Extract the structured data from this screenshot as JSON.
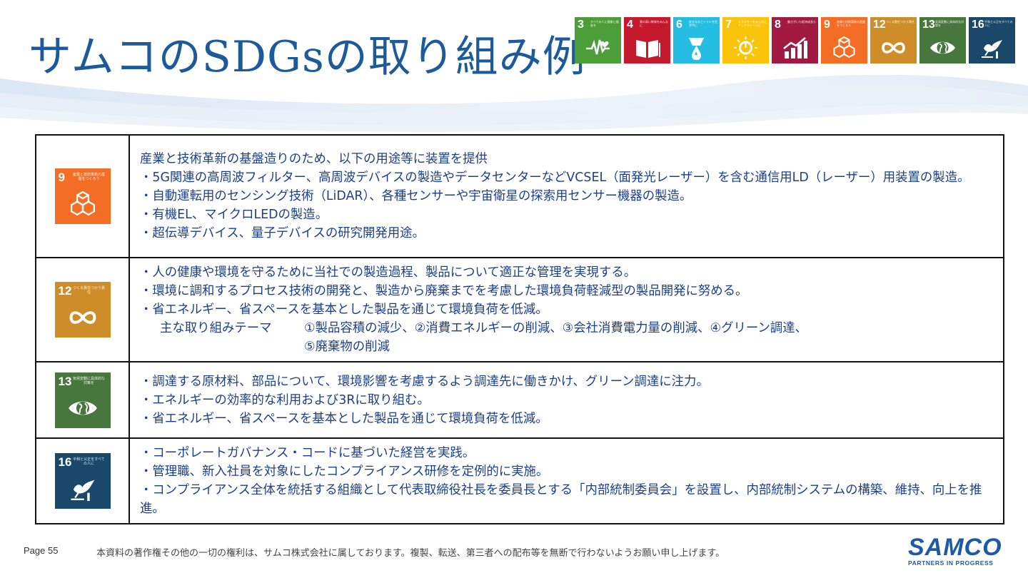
{
  "title": "サムコのSDGsの取り組み例",
  "header_icons": [
    {
      "number": "3",
      "caption": "すべての人に健康と福祉を",
      "color": "#4c9f38",
      "icon": "heartbeat-icon"
    },
    {
      "number": "4",
      "caption": "質の高い教育をみんなに",
      "color": "#c5192d",
      "icon": "book-icon"
    },
    {
      "number": "6",
      "caption": "安全な水とトイレを世界中に",
      "color": "#26bde2",
      "icon": "water-drop-icon"
    },
    {
      "number": "7",
      "caption": "エネルギーをみんなにそしてクリーンに",
      "color": "#fcc30b",
      "icon": "sun-power-icon"
    },
    {
      "number": "8",
      "caption": "働きがいも経済成長も",
      "color": "#a21942",
      "icon": "growth-chart-icon"
    },
    {
      "number": "9",
      "caption": "産業と技術革新の基盤をつくろう",
      "color": "#f36d25",
      "icon": "cubes-icon"
    },
    {
      "number": "12",
      "caption": "つくる責任つかう責任",
      "color": "#cf8d2a",
      "icon": "infinity-icon"
    },
    {
      "number": "13",
      "caption": "気候変動に具体的な対策を",
      "color": "#48773e",
      "icon": "eye-globe-icon"
    },
    {
      "number": "16",
      "caption": "平和と公正をすべての人に",
      "color": "#19486a",
      "icon": "dove-icon"
    }
  ],
  "rows": [
    {
      "icon": {
        "number": "9",
        "caption": "産業と技術革新の基盤をつくろう",
        "color": "#f36d25",
        "icon": "cubes-icon"
      },
      "lines": [
        "産業と技術革新の基盤造りのため、以下の用途等に装置を提供",
        "・5G関連の高周波フィルター、高周波デバイスの製造やデータセンターなどVCSEL（面発光レーザー）を含む通信用LD（レーザー）用装置の製造。",
        "・自動運転用のセンシング技術（LiDAR）、各種センサーや宇宙衛星の探索用センサー機器の製造。",
        "・有機EL、マイクロLEDの製造。",
        "・超伝導デバイス、量子デバイスの研究開発用途。"
      ]
    },
    {
      "icon": {
        "number": "12",
        "caption": "つくる責任つかう責任",
        "color": "#cf8d2a",
        "icon": "infinity-icon"
      },
      "lines": [
        "・人の健康や環境を守るために当社での製造過程、製品について適正な管理を実現する。",
        "・環境に調和するプロセス技術の開発と、製造から廃棄までを考慮した環境負荷軽減型の製品開発に努める。",
        "・省エネルギー、省スペースを基本とした製品を通じて環境負荷を低減。"
      ],
      "theme_label": "主な取り組みテーマ",
      "theme_lines": [
        "①製品容積の減少、②消費エネルギーの削減、③会社消費電力量の削減、④グリーン調達、",
        "⑤廃棄物の削減"
      ]
    },
    {
      "icon": {
        "number": "13",
        "caption": "気候変動に具体的な対策を",
        "color": "#48773e",
        "icon": "eye-globe-icon"
      },
      "lines": [
        "・調達する原材料、部品について、環境影響を考慮するよう調達先に働きかけ、グリーン調達に注力。",
        "・エネルギーの効率的な利用および3Rに取り組む。",
        "・省エネルギー、省スペースを基本とした製品を通じて環境負荷を低減。"
      ]
    },
    {
      "icon": {
        "number": "16",
        "caption": "平和と公正をすべての人に",
        "color": "#19486a",
        "icon": "dove-icon"
      },
      "lines": [
        "・コーポレートガバナンス・コードに基づいた経営を実践。",
        "・管理職、新入社員を対象にしたコンプライアンス研修を定例的に実施。",
        "・コンプライアンス全体を統括する組織として代表取締役社長を委員長とする「内部統制委員会」を設置し、内部統制システムの構築、維持、向上を推進。"
      ]
    }
  ],
  "footer": {
    "page": "Page 55",
    "copyright": "本資料の著作権その他の一切の権利は、サムコ株式会社に属しております。複製、転送、第三者への配布等を無断で行わないようお願い申し上げます。",
    "logo_text": "SAMCO",
    "logo_tagline": "PARTNERS IN PROGRESS"
  }
}
